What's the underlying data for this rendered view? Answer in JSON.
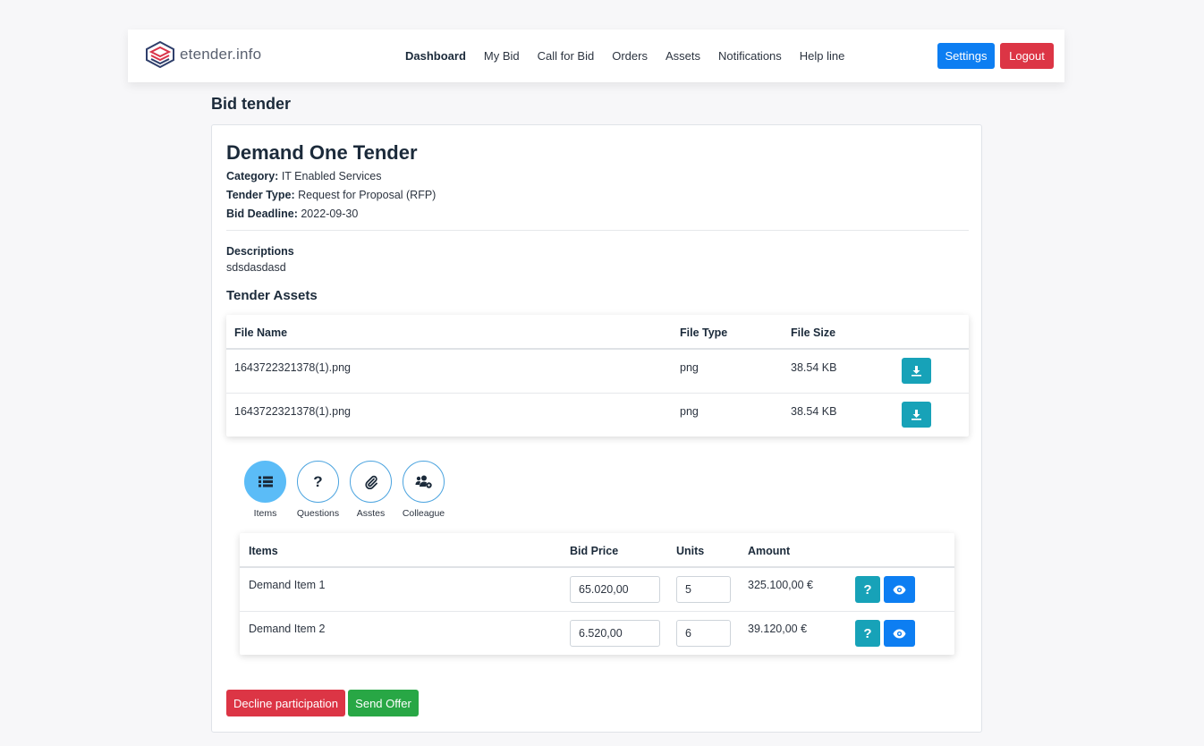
{
  "header": {
    "logo_text": "etender.info",
    "nav": [
      {
        "label": "Dashboard",
        "active": true
      },
      {
        "label": "My Bid"
      },
      {
        "label": "Call for Bid"
      },
      {
        "label": "Orders"
      },
      {
        "label": "Assets"
      },
      {
        "label": "Notifications"
      },
      {
        "label": "Help line"
      }
    ],
    "settings_label": "Settings",
    "logout_label": "Logout"
  },
  "page": {
    "title": "Bid tender"
  },
  "tender": {
    "title": "Demand One Tender",
    "category_label": "Category:",
    "category": "IT Enabled Services",
    "type_label": "Tender Type:",
    "type": "Request for Proposal (RFP)",
    "deadline_label": "Bid Deadline:",
    "deadline": "2022-09-30",
    "descriptions_label": "Descriptions",
    "descriptions": "sdsdasdasd"
  },
  "assets": {
    "title": "Tender Assets",
    "columns": [
      "File Name",
      "File Type",
      "File Size"
    ],
    "rows": [
      {
        "name": "1643722321378(1).png",
        "type": "png",
        "size": "38.54 KB"
      },
      {
        "name": "1643722321378(1).png",
        "type": "png",
        "size": "38.54 KB"
      }
    ]
  },
  "tabs": [
    {
      "label": "Items",
      "icon": "list-icon",
      "active": true
    },
    {
      "label": "Questions",
      "icon": "question-icon"
    },
    {
      "label": "Asstes",
      "icon": "paperclip-icon"
    },
    {
      "label": "Colleague",
      "icon": "users-cog-icon"
    }
  ],
  "items": {
    "columns": [
      "Items",
      "Bid Price",
      "Units",
      "Amount"
    ],
    "rows": [
      {
        "name": "Demand Item 1",
        "price": "65.020,00",
        "units": "5",
        "amount": "325.100,00 €"
      },
      {
        "name": "Demand Item 2",
        "price": "6.520,00",
        "units": "6",
        "amount": "39.120,00 €"
      }
    ],
    "question_symbol": "?"
  },
  "actions": {
    "decline_label": "Decline participation",
    "send_label": "Send Offer"
  },
  "colors": {
    "primary": "#0d7ef2",
    "danger": "#dc3545",
    "success": "#28a745",
    "info": "#17a2b8",
    "tab_active": "#5bbcf7"
  }
}
